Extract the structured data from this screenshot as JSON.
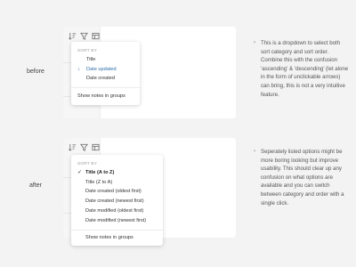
{
  "before": {
    "label": "before",
    "menu": {
      "header": "SORT BY",
      "items": [
        "Title",
        "Date updated",
        "Date created"
      ],
      "selected_index": 1,
      "footer": "Show notes in groups"
    },
    "note": "This is a dropdown to select both sort category and sort order. Combine this with the confusion ‘ascending’ & ‘descending’ (let alone in the form of unclickable arrows) can bring, this is not a very intuitive feature."
  },
  "after": {
    "label": "after",
    "menu": {
      "header": "SORT BY",
      "items": [
        "Title (A to Z)",
        "Title (Z to A)",
        "Date created (oldest first)",
        "Date created (newest first)",
        "Date modified (oldest first)",
        "Date modified (newest first)"
      ],
      "selected_index": 0,
      "footer": "Show notes in groups"
    },
    "note": "Seperately listed options might be more boring looking but improve usability. This should clear up any confusion on what options are available and you can switch between category and order with a single click."
  },
  "icons": {
    "sort": "sort-icon",
    "filter": "filter-icon",
    "view": "view-options-icon",
    "arrow_down": "arrow-down-icon",
    "check": "check-icon",
    "bullet": "chevron-right-icon"
  },
  "colors": {
    "accent": "#2f6fa8",
    "background": "#f3f3f3"
  }
}
